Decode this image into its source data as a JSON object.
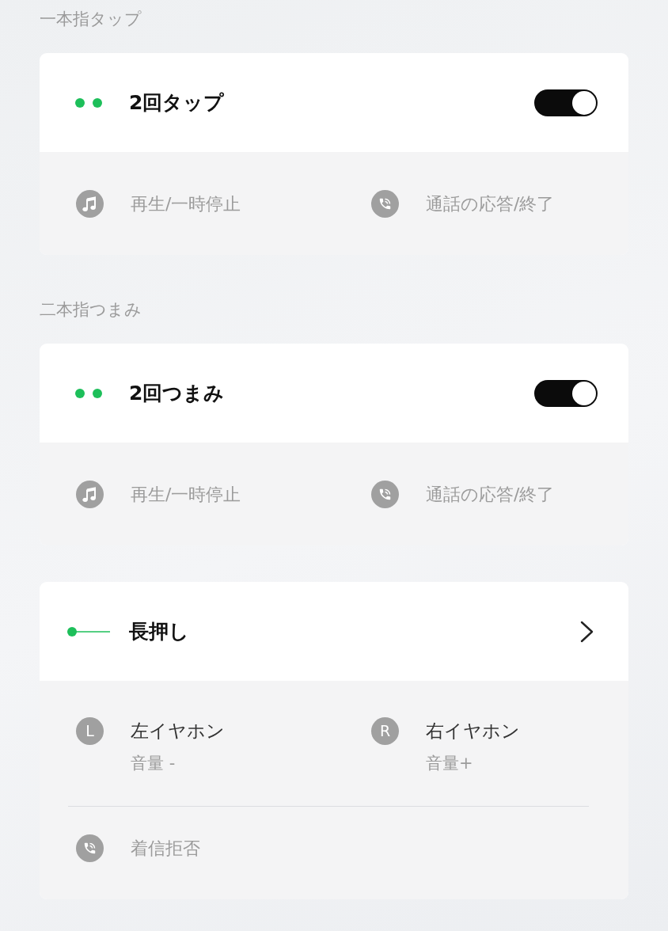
{
  "groups": [
    {
      "heading": "一本指タップ",
      "gesture": {
        "kind": "toggle",
        "indicator": {
          "kind": "double"
        },
        "title": "2回タップ",
        "on": true
      },
      "actions": [
        {
          "kind": "media",
          "label": "再生/一時停止"
        },
        {
          "kind": "call",
          "label": "通話の応答/終了"
        }
      ]
    },
    {
      "heading": "二本指つまみ",
      "gesture": {
        "kind": "toggle",
        "indicator": {
          "kind": "double"
        },
        "title": "2回つまみ",
        "on": true
      },
      "actions": [
        {
          "kind": "media",
          "label": "再生/一時停止"
        },
        {
          "kind": "call",
          "label": "通話の応答/終了"
        }
      ]
    },
    {
      "gesture": {
        "kind": "link",
        "indicator": {
          "kind": "hold"
        },
        "title": "長押し"
      },
      "earbuds": [
        {
          "badge": "L",
          "name": "左イヤホン",
          "action": "音量 -"
        },
        {
          "badge": "R",
          "name": "右イヤホン",
          "action": "音量+"
        }
      ],
      "actions": [
        {
          "kind": "call",
          "label": "着信拒否"
        }
      ]
    }
  ]
}
